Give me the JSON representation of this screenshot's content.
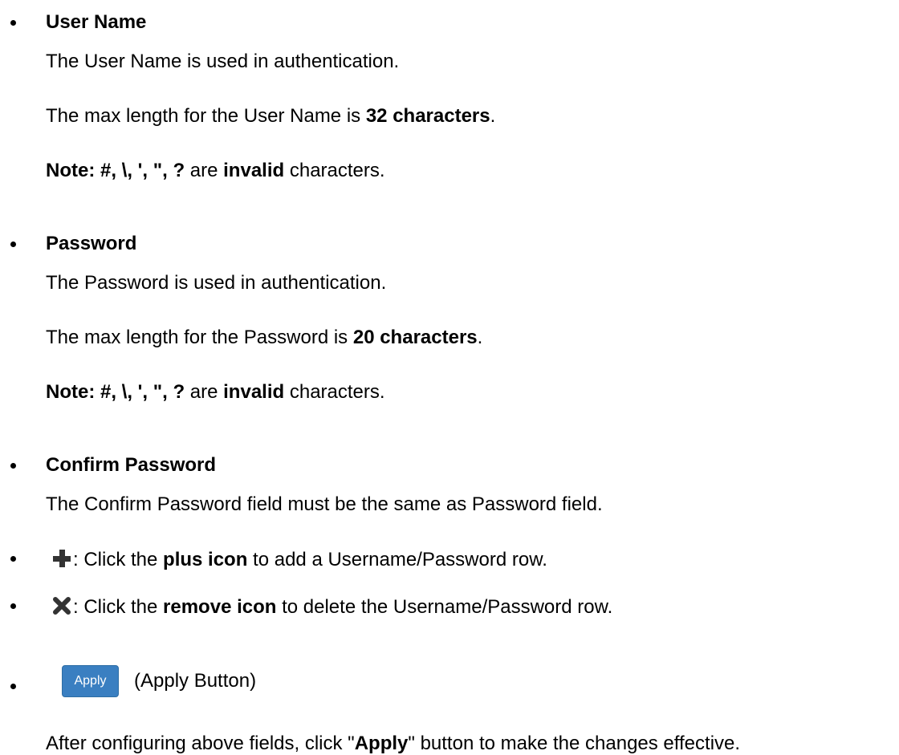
{
  "sections": {
    "user_name": {
      "heading": "User Name",
      "desc": "The User Name is used in authentication.",
      "maxlen_prefix": "The max length for the User Name is ",
      "maxlen_value": "32 characters",
      "maxlen_suffix": ".",
      "note_label": "Note: #, \\, ', \", ?",
      "note_middle": " are ",
      "note_invalid": "invalid",
      "note_suffix": " characters."
    },
    "password": {
      "heading": "Password",
      "desc": "The Password is used in authentication.",
      "maxlen_prefix": "The max length for the Password is ",
      "maxlen_value": "20 characters",
      "maxlen_suffix": ".",
      "note_label": "Note: #, \\, ', \", ?",
      "note_middle": " are ",
      "note_invalid": "invalid",
      "note_suffix": " characters."
    },
    "confirm_password": {
      "heading": "Confirm Password",
      "desc": "The Confirm Password field must be the same as Password field."
    },
    "plus": {
      "icon": "plus-icon",
      "prefix": ": Click the ",
      "bold": "plus icon",
      "suffix": " to add a Username/Password row."
    },
    "remove": {
      "icon": "remove-icon",
      "prefix": ": Click the ",
      "bold": "remove icon",
      "suffix": " to delete the Username/Password row."
    },
    "apply": {
      "button_label": "Apply",
      "caption": "(Apply Button)",
      "desc_prefix": "After configuring above fields, click \"",
      "desc_bold": "Apply",
      "desc_suffix": "\" button to make the changes effective."
    }
  },
  "colors": {
    "text": "#000000",
    "icon": "#333333",
    "apply_button": "#3a7fc1"
  }
}
